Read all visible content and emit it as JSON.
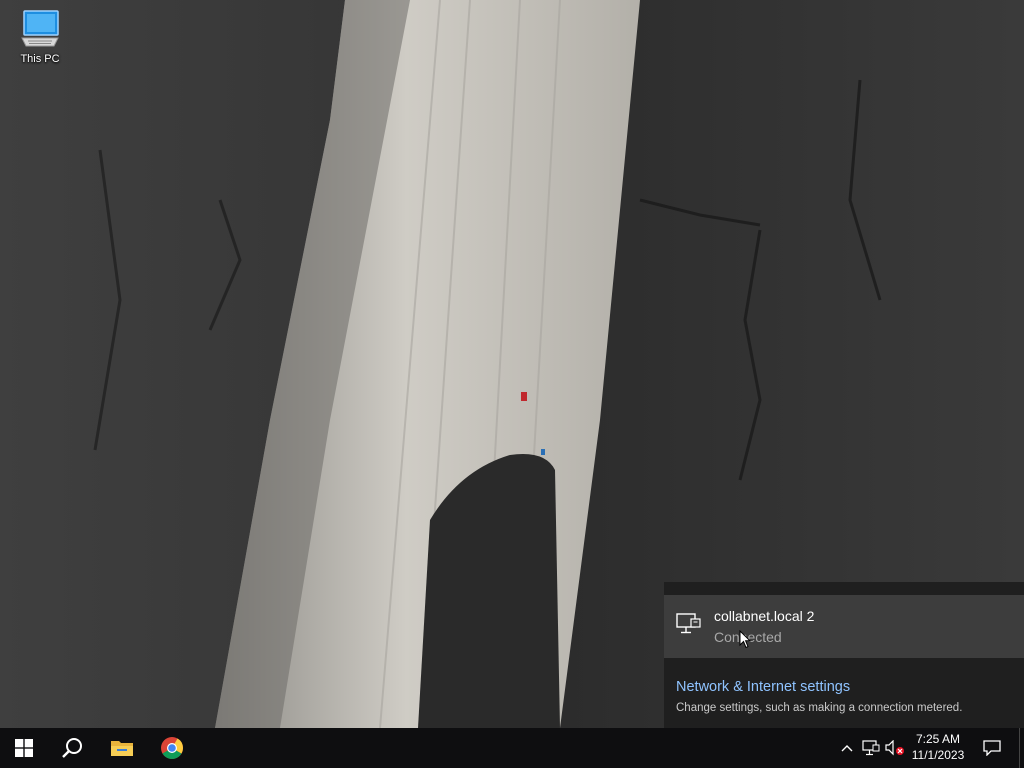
{
  "desktop": {
    "icons": [
      {
        "label": "This PC",
        "icon": "this-pc-icon"
      }
    ]
  },
  "network_flyout": {
    "connection": {
      "name": "collabnet.local 2",
      "status": "Connected",
      "icon": "ethernet-monitor-icon"
    },
    "settings_link": "Network & Internet settings",
    "settings_desc": "Change settings, such as making a connection metered."
  },
  "taskbar": {
    "pinned": [
      {
        "name": "start",
        "icon": "windows-logo-icon"
      },
      {
        "name": "search",
        "icon": "search-icon"
      },
      {
        "name": "file-explorer",
        "icon": "folder-icon"
      },
      {
        "name": "chrome",
        "icon": "chrome-icon"
      }
    ],
    "tray": {
      "icons": [
        "chevron-up-icon",
        "network-icon",
        "volume-muted-icon"
      ],
      "time": "7:25 AM",
      "date": "11/1/2023"
    }
  },
  "colors": {
    "taskbar_bg": "#0e0e10",
    "flyout_bg": "#1f1f1f",
    "flyout_item_bg": "#3d3d3d",
    "link": "#8fc3ff"
  }
}
